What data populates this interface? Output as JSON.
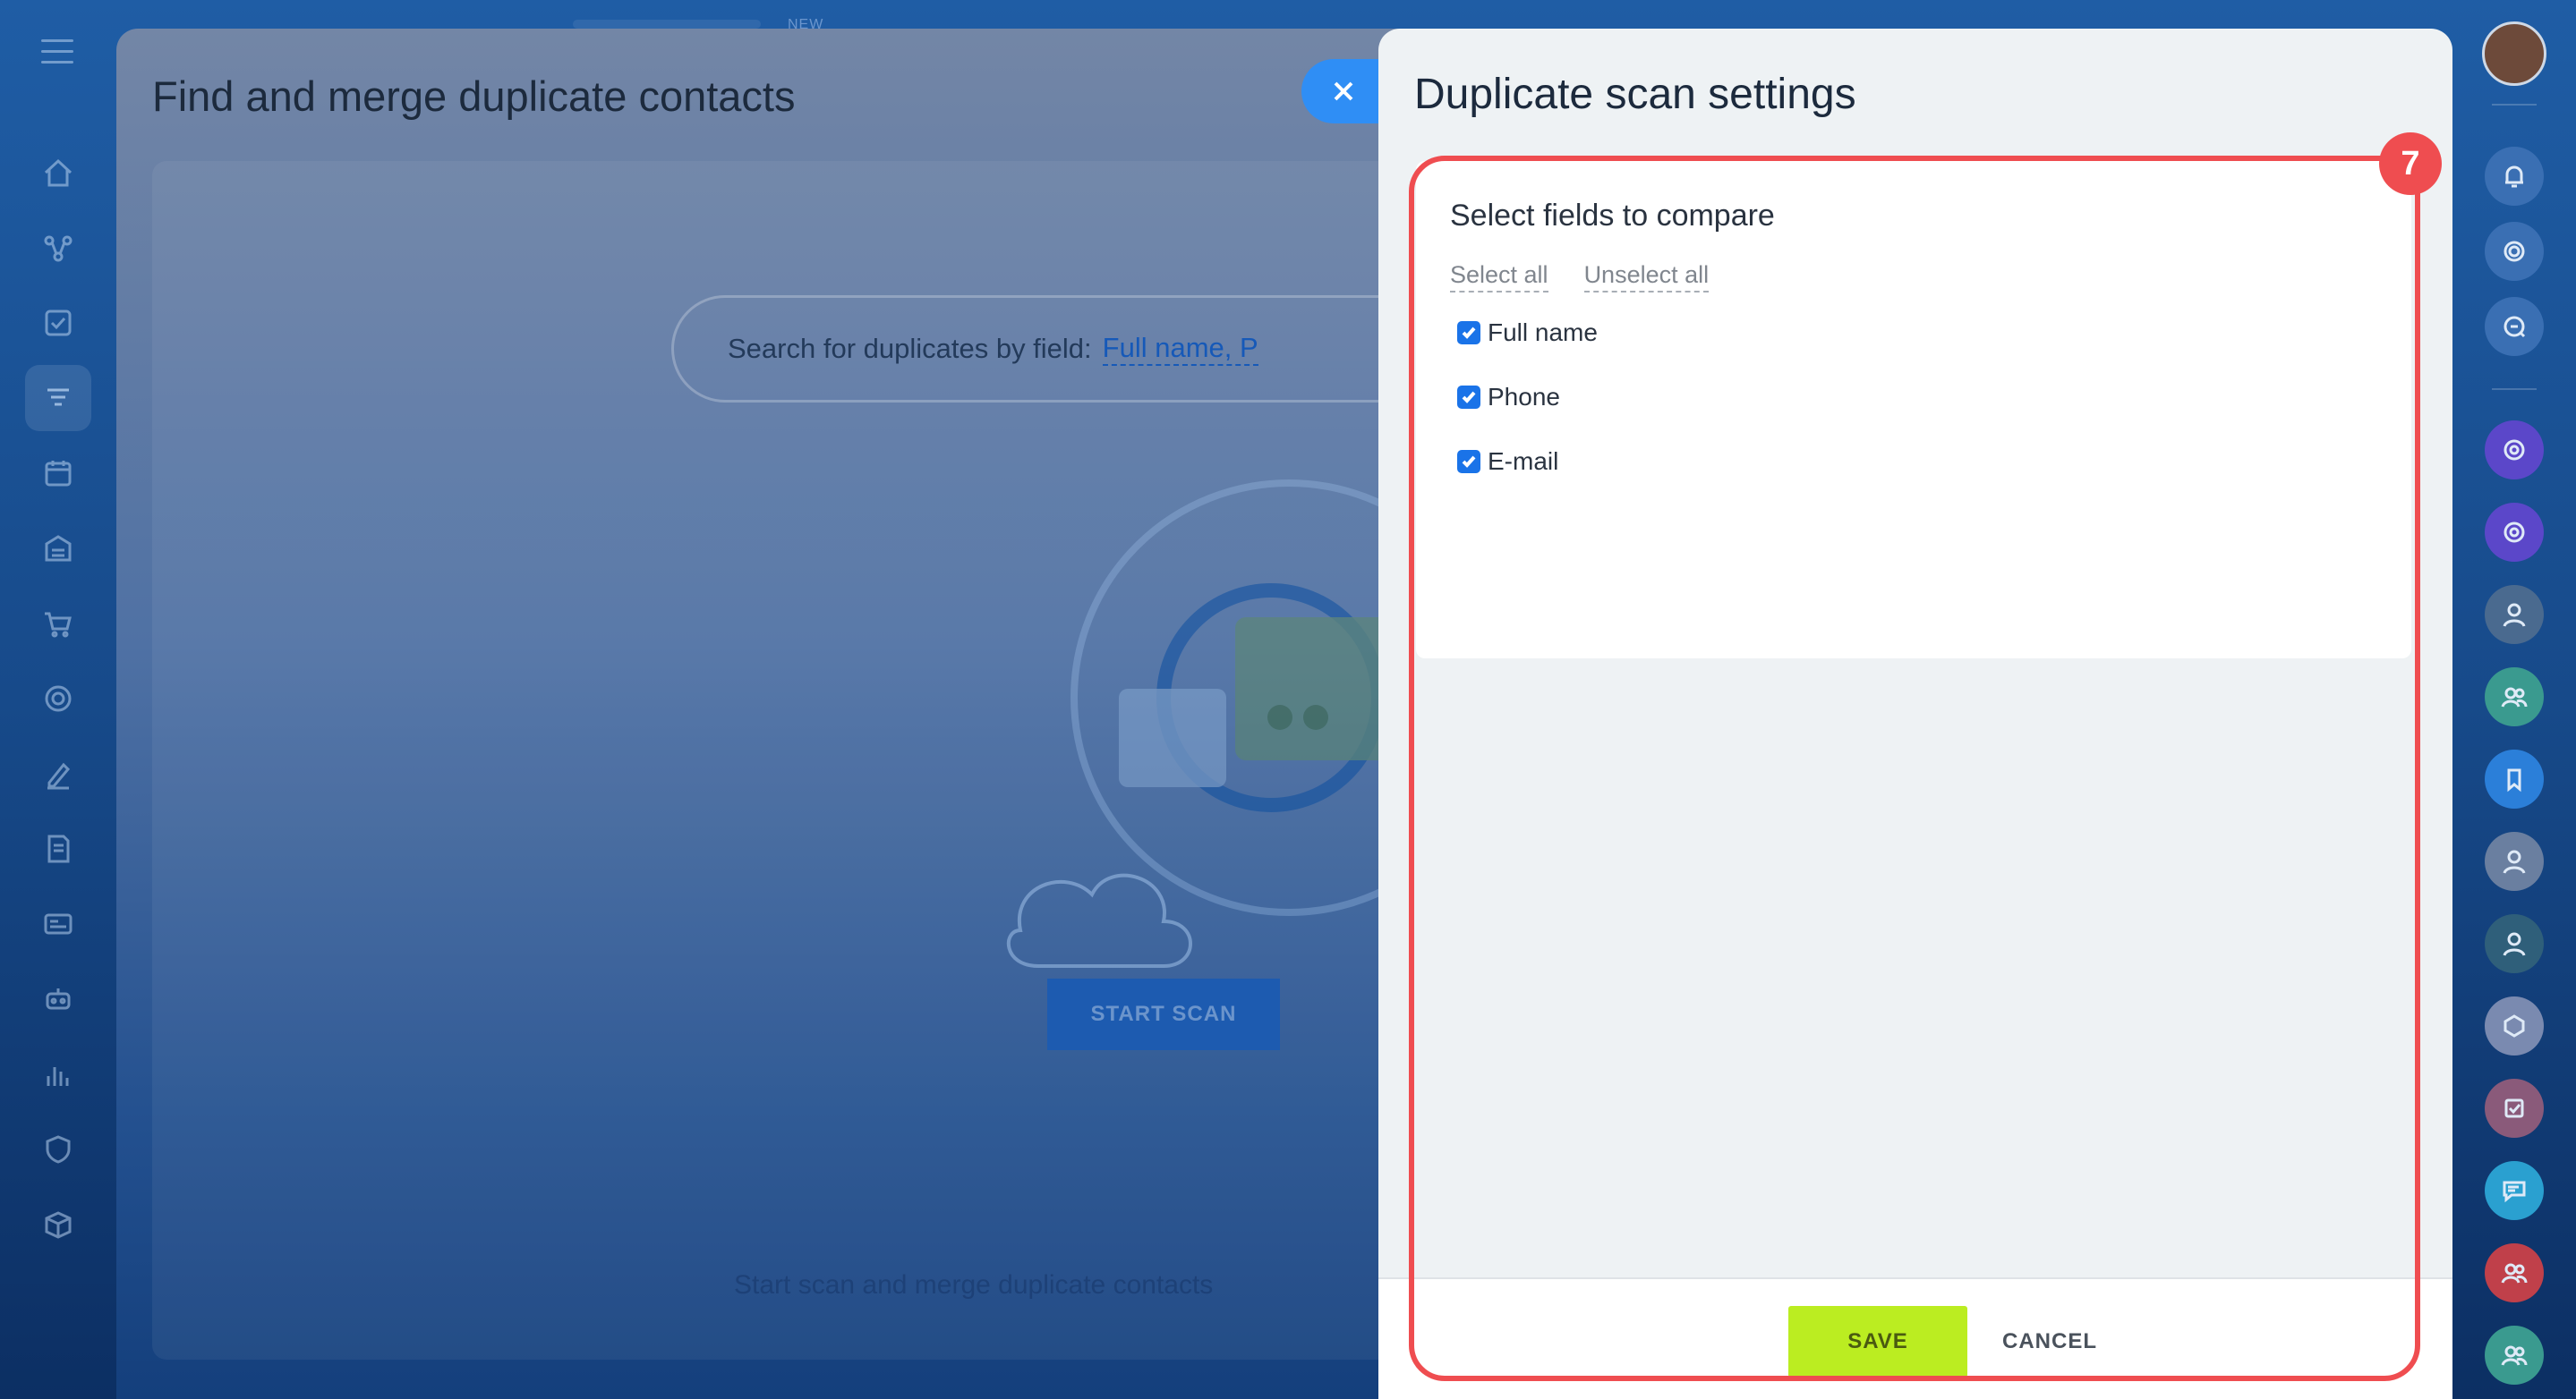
{
  "background": {
    "title": "Find and merge duplicate contacts",
    "search_prefix": "Search for duplicates by field:",
    "search_value": "Full name, P",
    "start_scan_label": "START SCAN",
    "footer_text": "Start scan and merge duplicate contacts",
    "new_label": "NEW"
  },
  "panel": {
    "title": "Duplicate scan settings",
    "section_title": "Select fields to compare",
    "select_all_label": "Select all",
    "unselect_all_label": "Unselect all",
    "fields": [
      {
        "label": "Full name",
        "checked": true
      },
      {
        "label": "Phone",
        "checked": true
      },
      {
        "label": "E-mail",
        "checked": true
      }
    ],
    "save_label": "SAVE",
    "cancel_label": "CANCEL"
  },
  "annotation": {
    "step_number": "7",
    "color": "#ef4d50"
  },
  "colors": {
    "save_button": "#bbed21",
    "checkbox": "#1a73e8",
    "close_button": "#2f8ef5"
  },
  "left_nav_icons": [
    "home-icon",
    "flow-icon",
    "tasks-icon",
    "crm-icon",
    "calendar-icon",
    "store-icon",
    "cart-icon",
    "target-icon",
    "sign-icon",
    "docs-icon",
    "cards-icon",
    "robot-icon",
    "chart-icon",
    "shield-icon",
    "box-icon"
  ],
  "right_bar_icons": [
    "bell-icon",
    "target-icon",
    "search-chat-icon",
    "copilot-icon",
    "copilot-icon",
    "user-avatar",
    "group-icon",
    "bookmark-icon",
    "user-avatar",
    "user-avatar",
    "group-avatar",
    "tasks-icon",
    "chat-icon",
    "group-icon",
    "group-icon"
  ]
}
